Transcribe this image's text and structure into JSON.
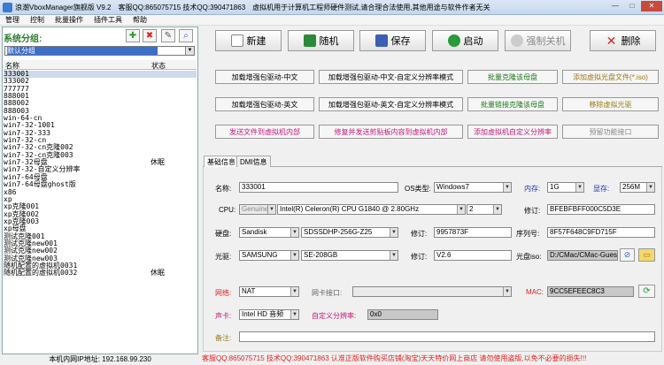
{
  "titlebar": {
    "title": "浪潮VboxManager旗舰版 V9.2",
    "contact": "客服QQ:865075715 技术QQ:390471863",
    "notice": "虚拟机用于计算机工程师硬件测试,请合理合法使用,其他用途与软件作者无关"
  },
  "menu": [
    "管理",
    "控制",
    "批量操作",
    "插件工具",
    "帮助"
  ],
  "group": {
    "header": "系统分组:",
    "selected": "默认分组"
  },
  "list": {
    "col_name": "名称",
    "col_status": "状态",
    "rows": [
      {
        "name": "333001",
        "status": ""
      },
      {
        "name": "333002",
        "status": ""
      },
      {
        "name": "777777",
        "status": ""
      },
      {
        "name": "888001",
        "status": ""
      },
      {
        "name": "888002",
        "status": ""
      },
      {
        "name": "888003",
        "status": ""
      },
      {
        "name": "win-64-cn",
        "status": ""
      },
      {
        "name": "win7-32-1001",
        "status": ""
      },
      {
        "name": "win7-32-333",
        "status": ""
      },
      {
        "name": "win7-32-cn",
        "status": ""
      },
      {
        "name": "win7-32-cn克隆002",
        "status": ""
      },
      {
        "name": "win7-32-cn克隆003",
        "status": ""
      },
      {
        "name": "win7-32母盘",
        "status": "休眠"
      },
      {
        "name": "win7-32-自定义分辨率",
        "status": ""
      },
      {
        "name": "win7-64母盘",
        "status": ""
      },
      {
        "name": "win7-64母盘ghost版",
        "status": ""
      },
      {
        "name": "x86",
        "status": ""
      },
      {
        "name": "xp",
        "status": ""
      },
      {
        "name": "xp克隆001",
        "status": ""
      },
      {
        "name": "xp克隆002",
        "status": ""
      },
      {
        "name": "xp克隆003",
        "status": ""
      },
      {
        "name": "xp母盘",
        "status": ""
      },
      {
        "name": "测试克隆001",
        "status": ""
      },
      {
        "name": "测试克隆new001",
        "status": ""
      },
      {
        "name": "测试克隆new002",
        "status": ""
      },
      {
        "name": "测试克隆new003",
        "status": ""
      },
      {
        "name": "随机配置的虚拟机0031",
        "status": ""
      },
      {
        "name": "随机配置的虚拟机0032",
        "status": "休眠"
      }
    ]
  },
  "status_left": "本机内网IP地址: 192.168.99.230",
  "toolbar": {
    "new": "新建",
    "random": "随机",
    "save": "保存",
    "start": "启动",
    "force_off": "强制关机",
    "delete": "删除"
  },
  "func_buttons": [
    [
      "加载增强包驱动-中文",
      "加载增强包驱动-中文-自定义分辨率模式",
      "批量克隆该母盘",
      "添加虚拟光盘文件(*.iso)"
    ],
    [
      "加载增强包驱动-英文",
      "加载增强包驱动-英文-自定义分辨率模式",
      "批量链接克隆该母盘",
      "移除虚拟光驱"
    ],
    [
      "发送文件到虚拟机内部",
      "修复并发送剪贴板内容到虚拟机内部",
      "添加虚拟机自定义分辨率",
      "预留功能接口"
    ]
  ],
  "tabs": [
    "基础信息",
    "DMI信息"
  ],
  "form": {
    "name_label": "名称:",
    "name": "333001",
    "os_label": "OS类型:",
    "os": "Windows7",
    "mem_label": "内存:",
    "mem": "1G",
    "vram_label": "显存:",
    "vram": "256M",
    "cpu_label": "CPU:",
    "cpu_vendor": "GenuineIntel",
    "cpu_model": "Intel(R) Celeron(R) CPU G1840 @ 2.80GHz",
    "cpu_cores": "2",
    "rev_label": "修订:",
    "cpu_rev": "BFEBFBFF000C5D3E",
    "disk_label": "硬盘:",
    "disk_vendor": "Sandisk",
    "disk_model": "SDSSDHP-256G-Z25",
    "disk_rev_label": "修订:",
    "disk_rev": "9957873F",
    "serial_label": "序列号:",
    "serial": "8F57F648C9FD715F",
    "optical_label": "光驱:",
    "optical_vendor": "SAMSUNG",
    "optical_model": "SE-208GB",
    "optical_rev_label": "修订:",
    "optical_rev": "V2.6",
    "cdiso_label": "光盘iso:",
    "cdiso": "D:/CMac/CMac-Guest.i",
    "net_label": "网络:",
    "net": "NAT",
    "nic_label": "网卡接口:",
    "nic": "",
    "mac_label": "MAC:",
    "mac": "9CC5EFEEC8C3",
    "sound_label": "声卡:",
    "sound": "Intel HD 音频",
    "res_label": "自定义分辨率:",
    "res": "0x0",
    "note_label": "备注:",
    "note": ""
  },
  "footer": "客服QQ:865075715 技术QQ:390471863 认准正版软件购买店铺(淘宝)天天特价网上商店 请勿使用盗版,以免不必要的损失!!!"
}
